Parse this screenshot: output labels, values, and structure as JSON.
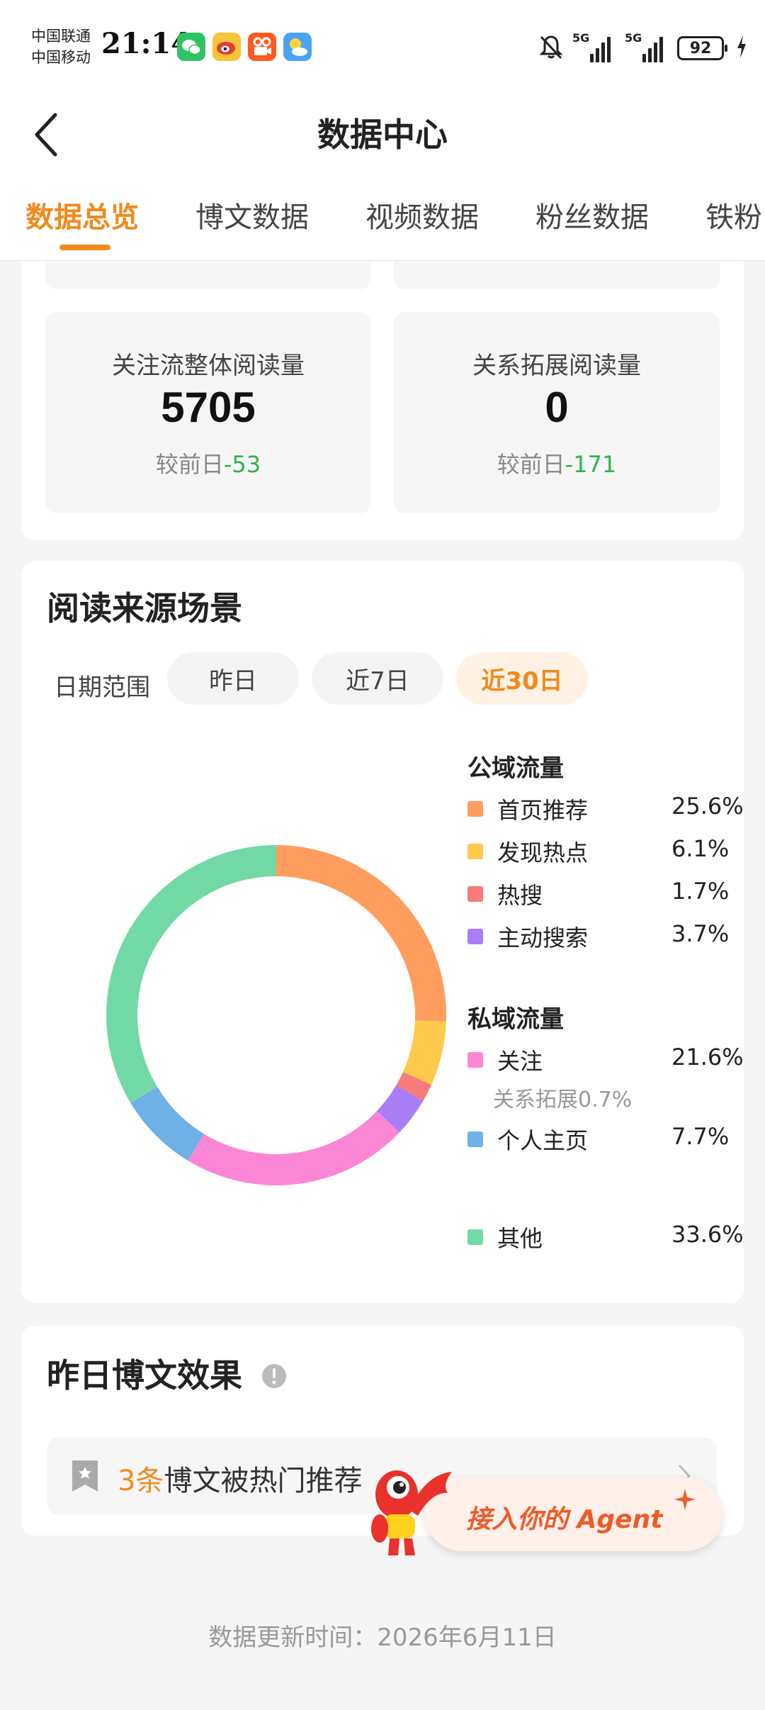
{
  "status_bar": {
    "carrier_1": "中国联通",
    "carrier_2": "中国移动",
    "time": "21:14",
    "battery": "92",
    "signal_1": "5G",
    "signal_2": "5G",
    "apps": [
      "wechat-icon",
      "weibo-icon",
      "kuaishou-icon",
      "weather-icon"
    ]
  },
  "header": {
    "title": "数据中心"
  },
  "tabs": [
    {
      "label": "数据总览",
      "active": true
    },
    {
      "label": "博文数据"
    },
    {
      "label": "视频数据"
    },
    {
      "label": "粉丝数据"
    },
    {
      "label": "铁粉"
    }
  ],
  "stats": [
    {
      "label": "关注流整体阅读量",
      "value": "5705",
      "change_prefix": "较前日",
      "change": "-53"
    },
    {
      "label": "关系拓展阅读量",
      "value": "0",
      "change_prefix": "较前日",
      "change": "-171"
    }
  ],
  "read_source": {
    "title": "阅读来源场景",
    "range_label": "日期范围",
    "ranges": [
      {
        "label": "昨日"
      },
      {
        "label": "近7日"
      },
      {
        "label": "近30日",
        "active": true
      }
    ],
    "public_title": "公域流量",
    "private_title": "私域流量",
    "legend": [
      {
        "name": "首页推荐",
        "percent": "25.6%",
        "value": 25.6,
        "color": "#ff9d5e"
      },
      {
        "name": "发现热点",
        "percent": "6.1%",
        "value": 6.1,
        "color": "#ffc94d"
      },
      {
        "name": "热搜",
        "percent": "1.7%",
        "value": 1.7,
        "color": "#f97a7a"
      },
      {
        "name": "主动搜索",
        "percent": "3.7%",
        "value": 3.7,
        "color": "#a97ef7"
      },
      {
        "name": "关注",
        "percent": "21.6%",
        "value": 21.6,
        "color": "#fb86d6"
      },
      {
        "name": "个人主页",
        "percent": "7.7%",
        "value": 7.7,
        "color": "#6fb0e6"
      },
      {
        "name": "其他",
        "percent": "33.6%",
        "value": 33.6,
        "color": "#72d9a6"
      }
    ],
    "follow_sub": "关系拓展0.7%"
  },
  "chart_data": {
    "type": "pie",
    "categories": [
      "首页推荐",
      "发现热点",
      "热搜",
      "主动搜索",
      "关注",
      "个人主页",
      "其他"
    ],
    "values": [
      25.6,
      6.1,
      1.7,
      3.7,
      21.6,
      7.7,
      33.6
    ],
    "colors": [
      "#ff9d5e",
      "#ffc94d",
      "#f97a7a",
      "#a97ef7",
      "#fb86d6",
      "#6fb0e6",
      "#72d9a6"
    ],
    "donut": true,
    "legend_position": "right"
  },
  "yesterday": {
    "title": "昨日博文效果",
    "count": "3条",
    "text": "博文被热门推荐"
  },
  "agent": {
    "label": "接入你的 Agent"
  },
  "footer": {
    "text": "数据更新时间：2026年6月11日"
  }
}
